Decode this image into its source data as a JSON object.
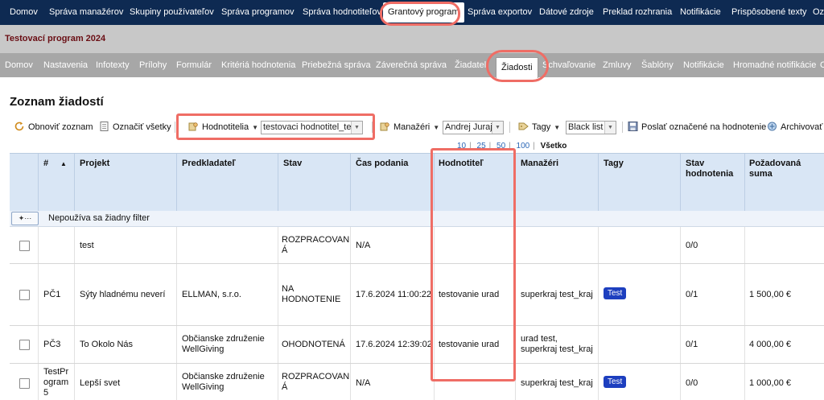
{
  "top_nav": {
    "items": [
      {
        "label": "Domov"
      },
      {
        "label": "Správa manažérov"
      },
      {
        "label": "Skupiny používateľov"
      },
      {
        "label": "Správa programov"
      },
      {
        "label": "Správa hodnotiteľov"
      },
      {
        "label": "Grantový program"
      },
      {
        "label": "Správa exportov"
      },
      {
        "label": "Dátové zdroje"
      },
      {
        "label": "Preklad rozhrania"
      },
      {
        "label": "Notifikácie"
      },
      {
        "label": "Prispôsobené texty"
      },
      {
        "label": "Oz"
      }
    ],
    "active_index": 5
  },
  "program_title": "Testovací program 2024",
  "sub_nav": {
    "items": [
      {
        "label": "Domov"
      },
      {
        "label": "Nastavenia"
      },
      {
        "label": "Infotexty"
      },
      {
        "label": "Prílohy"
      },
      {
        "label": "Formulár"
      },
      {
        "label": "Kritériá hodnotenia"
      },
      {
        "label": "Priebežná správa"
      },
      {
        "label": "Záverečná správa"
      },
      {
        "label": "Žiadatel"
      },
      {
        "label": "Žiadosti"
      },
      {
        "label": "Schvaľovanie"
      },
      {
        "label": "Zmluvy"
      },
      {
        "label": "Šablóny"
      },
      {
        "label": "Notifikácie"
      },
      {
        "label": "Hromadné notifikácie"
      },
      {
        "label": "O"
      }
    ],
    "active_index": 9
  },
  "page_title": "Zoznam žiadostí",
  "toolbar": {
    "refresh_label": "Obnoviť zoznam",
    "mark_all_label": "Označiť všetky",
    "evaluators_label": "Hodnotitelia",
    "evaluators_value": "testovaci hodnotitel_test",
    "managers_label": "Manažéri",
    "managers_value": "Andrej Juraj",
    "tags_label": "Tagy",
    "tags_value": "Black list",
    "send_label": "Poslať označené na hodnotenie",
    "archive_label": "Archivovať"
  },
  "pager": {
    "options": [
      "10",
      "25",
      "50",
      "100"
    ],
    "current": "Všetko"
  },
  "table": {
    "columns": {
      "num": "#",
      "project": "Projekt",
      "applicant": "Predkladateľ",
      "state": "Stav",
      "submitted": "Čas podania",
      "evaluator": "Hodnotiteľ",
      "managers": "Manažéri",
      "tags": "Tagy",
      "eval_state_1": "Stav",
      "eval_state_2": "hodnotenia",
      "amount": "Požadovaná suma"
    },
    "filter_text": "Nepoužíva sa žiadny filter",
    "rows": [
      {
        "num": "",
        "project": "test",
        "applicant": "",
        "state": "ROZPRACOVAN Á",
        "submitted": "N/A",
        "evaluator": "",
        "managers": "",
        "tag": "",
        "eval_state": "0/0",
        "amount": ""
      },
      {
        "num": "PČ1",
        "project": "Sýty hladnému neverí",
        "applicant": "ELLMAN, s.r.o.",
        "state": "NA HODNOTENIE",
        "submitted": "17.6.2024 11:00:22",
        "evaluator": "testovanie urad",
        "managers": "superkraj test_kraj",
        "tag": "Test",
        "eval_state": "0/1",
        "amount": "1 500,00 €"
      },
      {
        "num": "PČ3",
        "project": "To Okolo Nás",
        "applicant": "Občianske združenie WellGiving",
        "state": "OHODNOTENÁ",
        "submitted": "17.6.2024 12:39:02",
        "evaluator": "testovanie urad",
        "managers": "urad test, superkraj test_kraj",
        "tag": "",
        "eval_state": "0/1",
        "amount": "4 000,00 €"
      },
      {
        "num": "TestPr ogram 5",
        "project": "Lepší svet",
        "applicant": "Občianske združenie WellGiving",
        "state": "ROZPRACOVAN Á",
        "submitted": "N/A",
        "evaluator": "",
        "managers": "superkraj test_kraj",
        "tag": "Test",
        "eval_state": "0/0",
        "amount": "1 000,00 €"
      }
    ]
  },
  "colors": {
    "top_nav_bg": "#0e2a52",
    "sub_nav_bg": "#a7a7a7",
    "program_bar_bg": "#c8c8c8",
    "program_title": "#6a0e14",
    "grid_header_bg": "#d9e6f5",
    "tag_bg": "#1d3fbf",
    "highlight": "#ef6d65"
  }
}
